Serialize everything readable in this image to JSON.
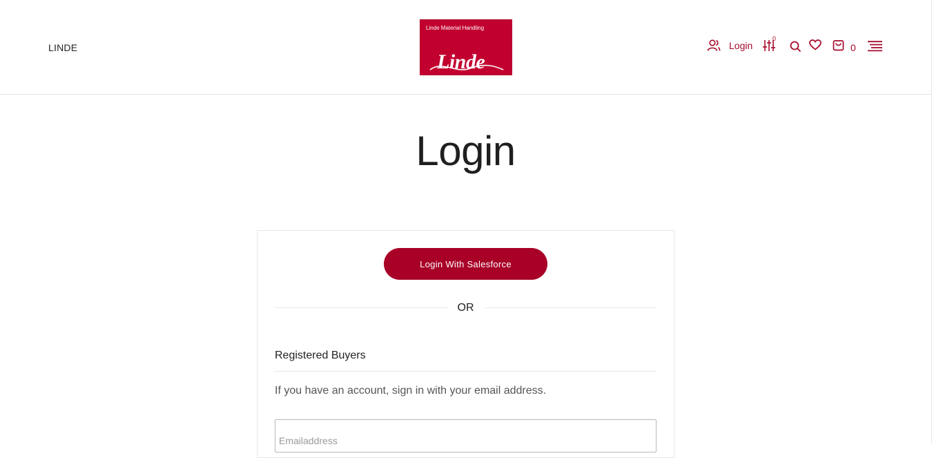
{
  "header": {
    "brand_text": "LINDE",
    "logo": {
      "tagline": "Linde Material Handling",
      "wordmark": "Linde"
    },
    "login_label": "Login",
    "compare_badge": "0",
    "cart_count": "0",
    "icons": [
      "user-icon",
      "compare-icon",
      "search-icon",
      "heart-icon",
      "shopping-bag-icon",
      "menu-icon"
    ]
  },
  "main": {
    "title": "Login",
    "salesforce_button": "Login With Salesforce",
    "or_text": "OR",
    "section_title": "Registered Buyers",
    "section_hint": "If you have an account, sign in with your email address.",
    "email_placeholder": "Emailaddress"
  },
  "colors": {
    "accent": "#a6092a",
    "logo_red": "#c2002f",
    "button": "#a80027"
  }
}
